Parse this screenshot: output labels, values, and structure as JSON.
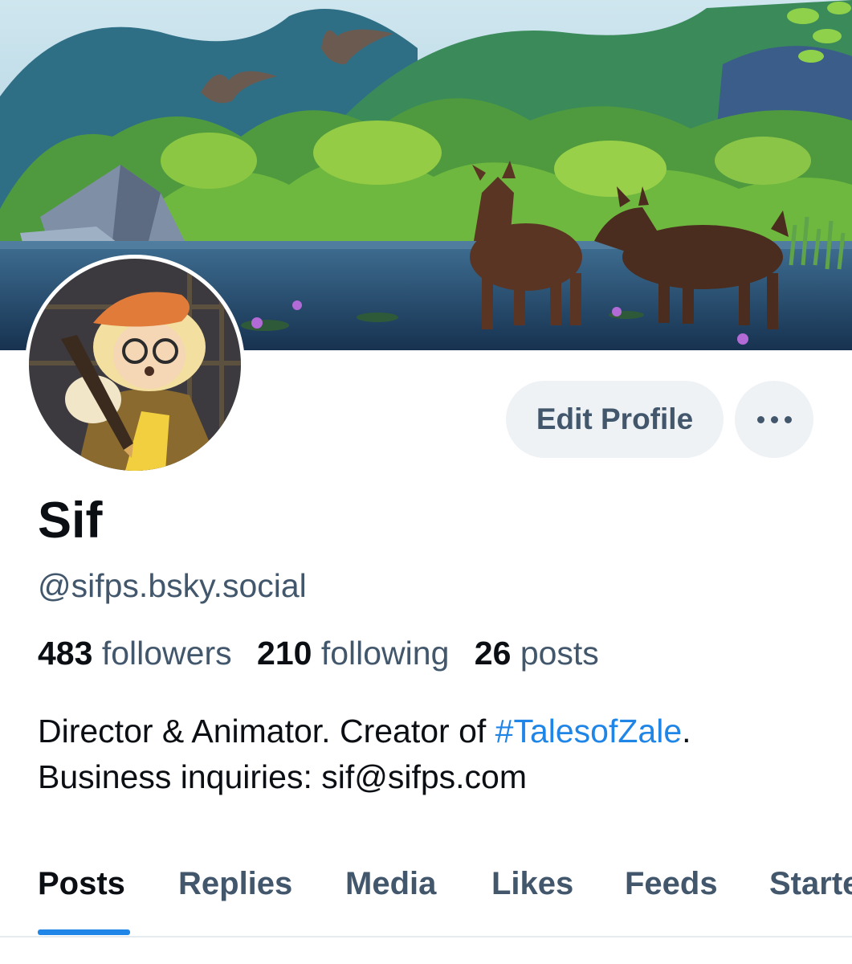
{
  "profile": {
    "display_name": "Sif",
    "handle": "@sifps.bsky.social",
    "stats": {
      "followers_count": "483",
      "followers_label": "followers",
      "following_count": "210",
      "following_label": "following",
      "posts_count": "26",
      "posts_label": "posts"
    },
    "bio": {
      "line1_before": "Director & Animator. Creator of ",
      "hashtag": "#TalesofZale",
      "line1_after": ".",
      "line2": "Business inquiries: sif@sifps.com"
    }
  },
  "actions": {
    "edit_profile_label": "Edit Profile",
    "more_icon": "ellipsis-icon"
  },
  "tabs": [
    {
      "label": "Posts",
      "active": true
    },
    {
      "label": "Replies",
      "active": false
    },
    {
      "label": "Media",
      "active": false
    },
    {
      "label": "Likes",
      "active": false
    },
    {
      "label": "Feeds",
      "active": false
    },
    {
      "label": "Starter Packs",
      "active": false
    }
  ],
  "colors": {
    "accent": "#1f85e6",
    "secondary_text": "#42576c",
    "primary_text": "#0b0f14",
    "button_bg": "#eff2f5"
  }
}
